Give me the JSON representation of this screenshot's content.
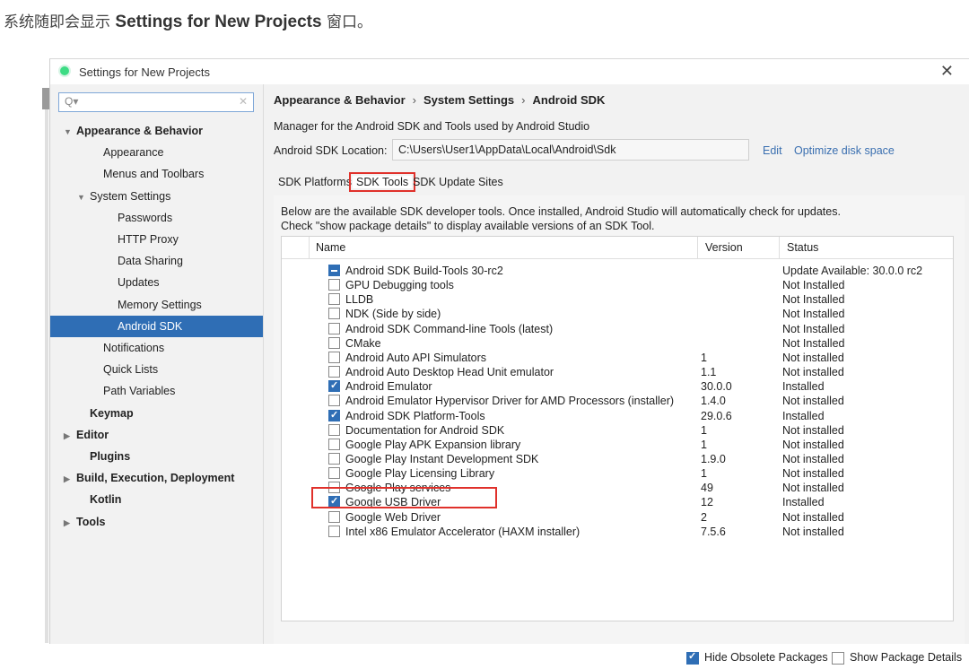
{
  "caption": {
    "prefix": "系统随即会显示 ",
    "bold": "Settings for New Projects",
    "suffix": " 窗口。"
  },
  "window": {
    "title": "Settings for New Projects",
    "close": "✕"
  },
  "search": {
    "value": ""
  },
  "sidebar": {
    "items": [
      {
        "label": "Appearance & Behavior",
        "arrow": "▼"
      },
      {
        "label": "Appearance"
      },
      {
        "label": "Menus and Toolbars"
      },
      {
        "label": "System Settings",
        "arrow": "▼"
      },
      {
        "label": "Passwords"
      },
      {
        "label": "HTTP Proxy"
      },
      {
        "label": "Data Sharing"
      },
      {
        "label": "Updates"
      },
      {
        "label": "Memory Settings"
      },
      {
        "label": "Android SDK"
      },
      {
        "label": "Notifications"
      },
      {
        "label": "Quick Lists"
      },
      {
        "label": "Path Variables"
      },
      {
        "label": "Keymap"
      },
      {
        "label": "Editor",
        "arrow": "▶"
      },
      {
        "label": "Plugins"
      },
      {
        "label": "Build, Execution, Deployment",
        "arrow": "▶"
      },
      {
        "label": "Kotlin"
      },
      {
        "label": "Tools",
        "arrow": "▶"
      }
    ]
  },
  "breadcrumb": {
    "a": "Appearance & Behavior",
    "b": "System Settings",
    "c": "Android SDK",
    "sep": "›"
  },
  "description": "Manager for the Android SDK and Tools used by Android Studio",
  "sdk_location": {
    "label": "Android SDK Location:",
    "value": "C:\\Users\\User1\\AppData\\Local\\Android\\Sdk",
    "edit": "Edit",
    "optimize": "Optimize disk space"
  },
  "tabs": {
    "platforms": "SDK Platforms",
    "tools": "SDK Tools",
    "sites": "SDK Update Sites"
  },
  "info": {
    "line1": "Below are the available SDK developer tools. Once installed, Android Studio will automatically check for updates.",
    "line2": "Check \"show package details\" to display available versions of an SDK Tool."
  },
  "table": {
    "headers": {
      "name": "Name",
      "version": "Version",
      "status": "Status"
    },
    "rows": [
      {
        "name": "Android SDK Build-Tools 30-rc2",
        "version": "",
        "status": "Update Available: 30.0.0 rc2",
        "state": "partial"
      },
      {
        "name": "GPU Debugging tools",
        "version": "",
        "status": "Not Installed",
        "state": "unchecked"
      },
      {
        "name": "LLDB",
        "version": "",
        "status": "Not Installed",
        "state": "unchecked"
      },
      {
        "name": "NDK (Side by side)",
        "version": "",
        "status": "Not Installed",
        "state": "unchecked"
      },
      {
        "name": "Android SDK Command-line Tools (latest)",
        "version": "",
        "status": "Not Installed",
        "state": "unchecked"
      },
      {
        "name": "CMake",
        "version": "",
        "status": "Not Installed",
        "state": "unchecked"
      },
      {
        "name": "Android Auto API Simulators",
        "version": "1",
        "status": "Not installed",
        "state": "unchecked"
      },
      {
        "name": "Android Auto Desktop Head Unit emulator",
        "version": "1.1",
        "status": "Not installed",
        "state": "unchecked"
      },
      {
        "name": "Android Emulator",
        "version": "30.0.0",
        "status": "Installed",
        "state": "checked"
      },
      {
        "name": "Android Emulator Hypervisor Driver for AMD Processors (installer)",
        "version": "1.4.0",
        "status": "Not installed",
        "state": "unchecked"
      },
      {
        "name": "Android SDK Platform-Tools",
        "version": "29.0.6",
        "status": "Installed",
        "state": "checked"
      },
      {
        "name": "Documentation for Android SDK",
        "version": "1",
        "status": "Not installed",
        "state": "unchecked"
      },
      {
        "name": "Google Play APK Expansion library",
        "version": "1",
        "status": "Not installed",
        "state": "unchecked"
      },
      {
        "name": "Google Play Instant Development SDK",
        "version": "1.9.0",
        "status": "Not installed",
        "state": "unchecked"
      },
      {
        "name": "Google Play Licensing Library",
        "version": "1",
        "status": "Not installed",
        "state": "unchecked"
      },
      {
        "name": "Google Play services",
        "version": "49",
        "status": "Not installed",
        "state": "unchecked"
      },
      {
        "name": "Google USB Driver",
        "version": "12",
        "status": "Installed",
        "state": "checked"
      },
      {
        "name": "Google Web Driver",
        "version": "2",
        "status": "Not installed",
        "state": "unchecked"
      },
      {
        "name": "Intel x86 Emulator Accelerator (HAXM installer)",
        "version": "7.5.6",
        "status": "Not installed",
        "state": "unchecked"
      }
    ]
  },
  "footer": {
    "hide_obsolete": "Hide Obsolete Packages",
    "hide_checked": true,
    "show_details": "Show Package Details",
    "show_checked": false
  },
  "colors": {
    "accent": "#2f6eb5",
    "highlight": "#e0312b",
    "link": "#3a6fb0"
  }
}
